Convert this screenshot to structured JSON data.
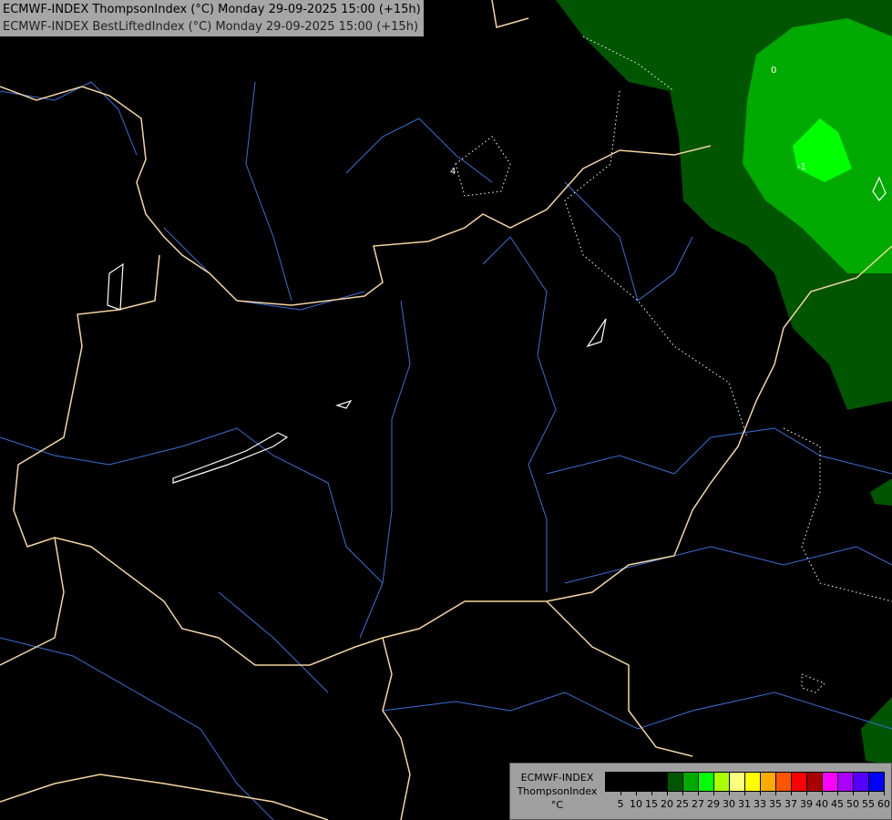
{
  "header": {
    "line1": "ECMWF-INDEX ThompsonIndex (°C) Monday 29-09-2025 15:00 (+15h)",
    "line2": "ECMWF-INDEX BestLiftedIndex (°C) Monday 29-09-2025 15:00 (+15h)"
  },
  "legend": {
    "model": "ECMWF-INDEX",
    "parameter": "ThompsonIndex",
    "unit": "°C",
    "labels": [
      "5",
      "10",
      "15",
      "20",
      "25",
      "27",
      "29",
      "30",
      "31",
      "33",
      "35",
      "37",
      "39",
      "40",
      "45",
      "50",
      "55",
      "60"
    ],
    "colors": [
      "#000000",
      "#000000",
      "#000000",
      "#000000",
      "#005500",
      "#00aa00",
      "#00ff00",
      "#aaff00",
      "#ffff80",
      "#ffff00",
      "#ffaa00",
      "#ff5500",
      "#ff0000",
      "#aa0000",
      "#ff00ff",
      "#aa00ff",
      "#5500ff",
      "#0000ff"
    ]
  },
  "map": {
    "border_color": "#f5d6a0",
    "river_color": "#3a6fd8",
    "shading_colors": [
      "#005500",
      "#00aa00",
      "#00ff00"
    ],
    "contour_labels": [
      "4",
      "0",
      "-1"
    ]
  }
}
